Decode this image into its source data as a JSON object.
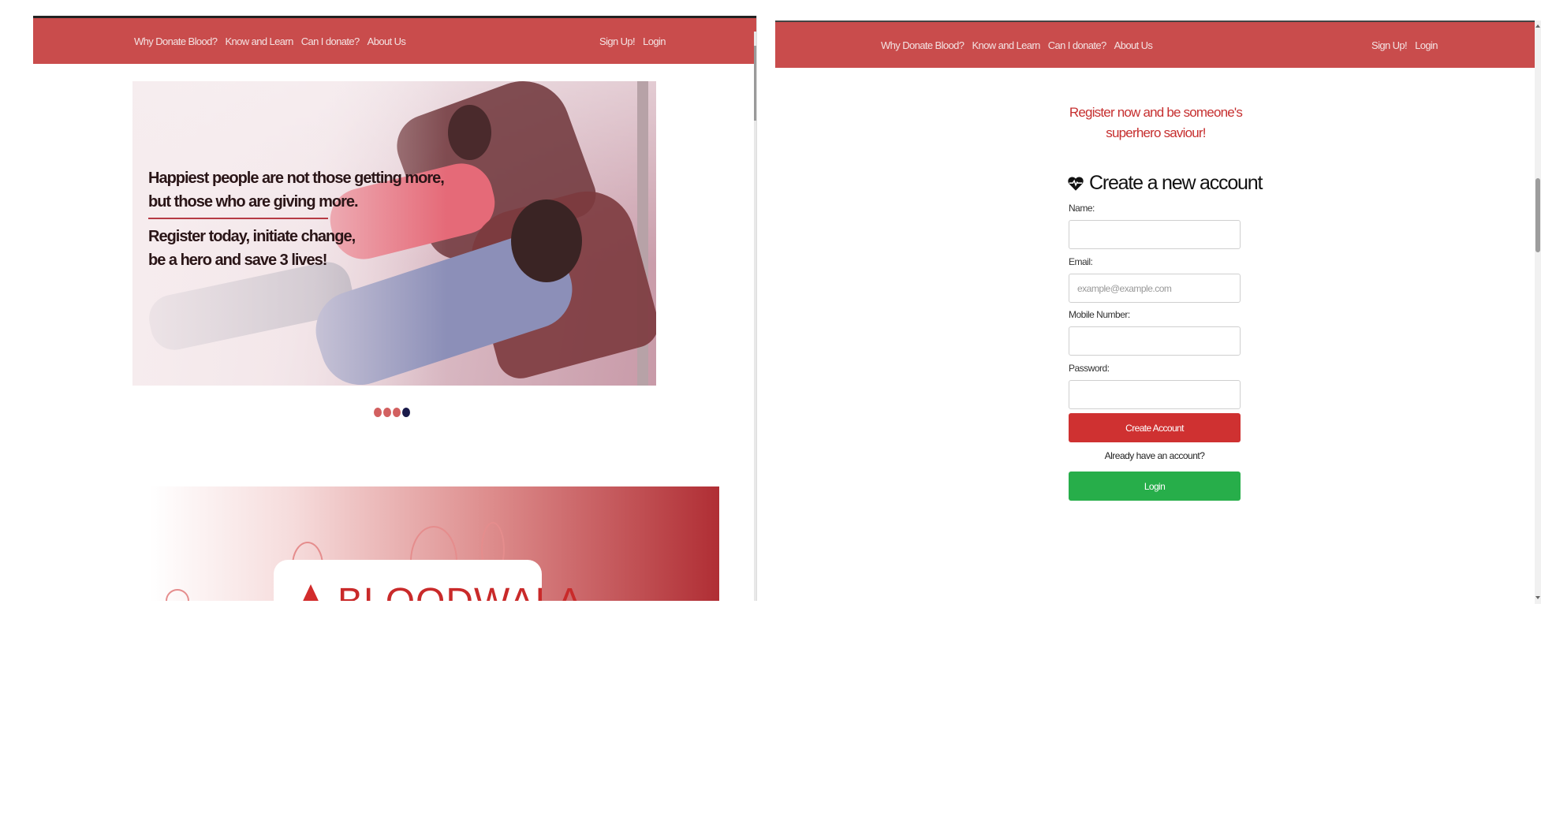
{
  "nav": {
    "links": [
      "Why Donate Blood?",
      "Know and Learn",
      "Can I donate?",
      "About Us"
    ],
    "auth": [
      "Sign Up!",
      "Login"
    ]
  },
  "home": {
    "hero": {
      "quote_line1": "Happiest people are not those getting more,",
      "quote_line2": "but those who are giving more.",
      "cta_line1": "Register today, initiate change,",
      "cta_line2": "be a hero and save 3 lives!"
    },
    "carousel": {
      "slide_count": 4,
      "active_index": 3
    },
    "banner": {
      "brand": "BLOODWALA"
    }
  },
  "register": {
    "tagline_line1": "Register now and be someone's",
    "tagline_line2": "superhero saviour!",
    "title": "Create a new account",
    "fields": {
      "name_label": "Name:",
      "email_label": "Email:",
      "email_placeholder": "example@example.com",
      "mobile_label": "Mobile Number:",
      "password_label": "Password:"
    },
    "create_button": "Create Account",
    "already_text": "Already have an account?",
    "login_button": "Login"
  },
  "colors": {
    "nav_bg": "#c94c4c",
    "accent_red": "#cf3131",
    "login_green": "#27ae4a",
    "carousel_dot": "#d26060",
    "carousel_dot_active": "#1a1a4a"
  }
}
